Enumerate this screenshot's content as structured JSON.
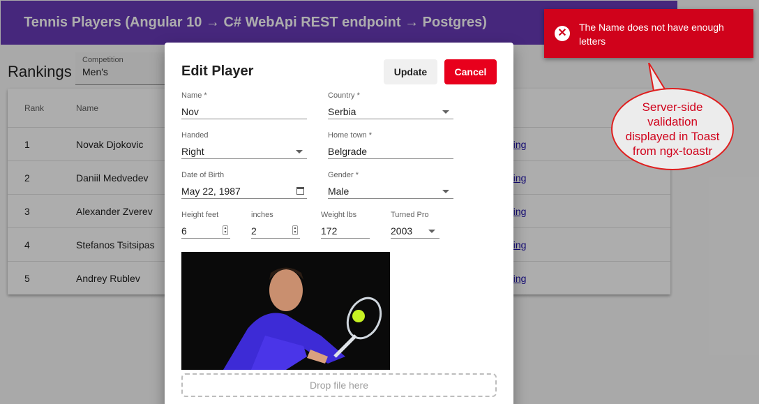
{
  "app": {
    "title": "Tennis Players (Angular 10 → C# WebApi REST endpoint → Postgres)",
    "page_heading": "Rankings",
    "competition": {
      "label": "Competition",
      "value": "Men's"
    }
  },
  "table": {
    "headers": {
      "rank": "Rank",
      "name": "Name"
    },
    "rows": [
      {
        "rank": "1",
        "name": "Novak Djokovic",
        "link": "nking"
      },
      {
        "rank": "2",
        "name": "Daniil Medvedev",
        "link": "nking"
      },
      {
        "rank": "3",
        "name": "Alexander Zverev",
        "link": "nking"
      },
      {
        "rank": "4",
        "name": "Stefanos Tsitsipas",
        "link": "nking"
      },
      {
        "rank": "5",
        "name": "Andrey Rublev",
        "link": "nking"
      }
    ]
  },
  "dialog": {
    "title": "Edit Player",
    "update_label": "Update",
    "cancel_label": "Cancel",
    "fields": {
      "name": {
        "label": "Name *",
        "value": "Nov"
      },
      "country": {
        "label": "Country *",
        "value": "Serbia"
      },
      "handed": {
        "label": "Handed",
        "value": "Right"
      },
      "home_town": {
        "label": "Home town *",
        "value": "Belgrade"
      },
      "dob": {
        "label": "Date of Birth",
        "value": "May 22, 1987"
      },
      "gender": {
        "label": "Gender *",
        "value": "Male"
      },
      "height_feet": {
        "label": "Height feet",
        "value": "6"
      },
      "inches": {
        "label": "inches",
        "value": "2"
      },
      "weight": {
        "label": "Weight lbs",
        "value": "172"
      },
      "turned_pro": {
        "label": "Turned Pro",
        "value": "2003"
      }
    },
    "dropzone_label": "Drop file here"
  },
  "toast": {
    "message": "The Name does not have enough letters",
    "color": "#d0021b"
  },
  "callout": {
    "text": "Server-side validation displayed in Toast from ngx-toastr"
  },
  "colors": {
    "topbar": "#673ab7",
    "cancel": "#e8001c"
  },
  "icons": [
    "error-icon",
    "calendar-icon",
    "chevron-down-icon",
    "spinner-icon"
  ]
}
